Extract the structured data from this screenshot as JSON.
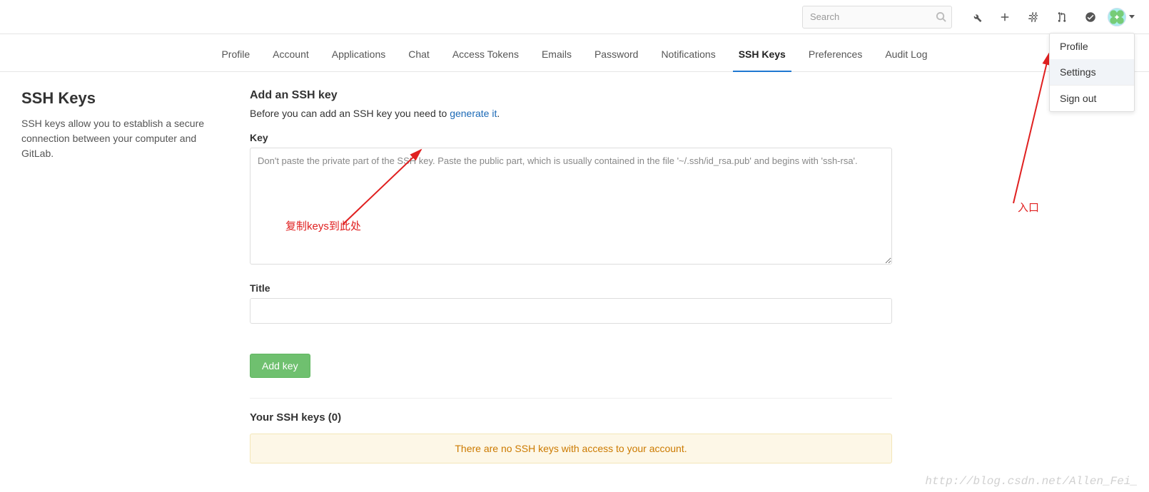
{
  "topbar": {
    "search_placeholder": "Search"
  },
  "dropdown": {
    "items": [
      {
        "label": "Profile"
      },
      {
        "label": "Settings",
        "active": true
      },
      {
        "label": "Sign out"
      }
    ]
  },
  "tabs": [
    {
      "label": "Profile"
    },
    {
      "label": "Account"
    },
    {
      "label": "Applications"
    },
    {
      "label": "Chat"
    },
    {
      "label": "Access Tokens"
    },
    {
      "label": "Emails"
    },
    {
      "label": "Password"
    },
    {
      "label": "Notifications"
    },
    {
      "label": "SSH Keys",
      "active": true
    },
    {
      "label": "Preferences"
    },
    {
      "label": "Audit Log"
    }
  ],
  "side": {
    "title": "SSH Keys",
    "description": "SSH keys allow you to establish a secure connection between your computer and GitLab."
  },
  "form": {
    "heading": "Add an SSH key",
    "helper_prefix": "Before you can add an SSH key you need to ",
    "helper_link": "generate it",
    "helper_suffix": ".",
    "key_label": "Key",
    "key_placeholder": "Don't paste the private part of the SSH key. Paste the public part, which is usually contained in the file '~/.ssh/id_rsa.pub' and begins with 'ssh-rsa'.",
    "title_label": "Title",
    "add_button": "Add key"
  },
  "keys_list": {
    "title": "Your SSH keys (0)",
    "empty_message": "There are no SSH keys with access to your account."
  },
  "annotations": {
    "copy_hint": "复制keys到此处",
    "entry_hint": "入口"
  },
  "watermark": "http://blog.csdn.net/Allen_Fei_"
}
